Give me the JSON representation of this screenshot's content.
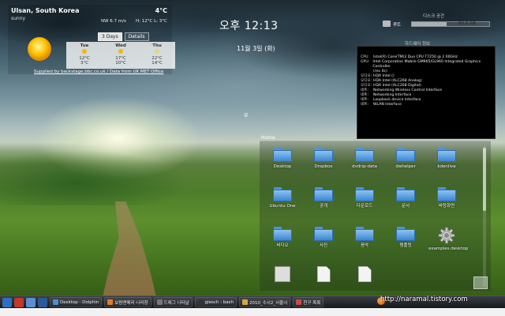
{
  "weather": {
    "city": "Ulsan, South Korea",
    "condition": "sunny",
    "temperature": "4°C",
    "wind": "NW 6.7 m/s",
    "hi_lo": "H: 12°C L: 3°C",
    "tabs": [
      "3 Days",
      "Details"
    ],
    "active_tab": 0,
    "forecast": [
      {
        "day": "Tue",
        "high": "12°C",
        "low": "3°C",
        "icon": "sun-icon"
      },
      {
        "day": "Wed",
        "high": "17°C",
        "low": "10°C",
        "icon": "sun-icon"
      },
      {
        "day": "Thu",
        "high": "22°C",
        "low": "14°C",
        "icon": "cloud-sun-icon"
      }
    ],
    "supplier": "Supplied by backstage.bbc.co.uk / Data from UK MET Office"
  },
  "clock": {
    "time": "오후 12:13",
    "date": "11월 3일 (화)"
  },
  "disk": {
    "title": "디스크 공간",
    "label": "루트",
    "value": "60.0 GB",
    "usage_fraction": 0.45
  },
  "sysinfo": {
    "title": "하드웨어 정보",
    "rows": [
      {
        "k": "CPU:",
        "v": "Intel(R) Core(TM)2 Duo CPU T7250 @ 2.00GHz"
      },
      {
        "k": "GPU:",
        "v": "Intel Corporation Mobile GM965/GL960 Integrated Graphics Controller"
      },
      {
        "k": "",
        "v": "(rev 0c)"
      },
      {
        "k": "오디오:",
        "v": "HDA Intel ()"
      },
      {
        "k": "오디오:",
        "v": "HDA Intel (ALC268 Analog)"
      },
      {
        "k": "오디오:",
        "v": "HDA Intel (ALC268 Digital)"
      },
      {
        "k": "네트:",
        "v": "Networking Wireless Control Interface"
      },
      {
        "k": "",
        "v": ""
      },
      {
        "k": "네트:",
        "v": "Networking Interface"
      },
      {
        "k": "",
        "v": ""
      },
      {
        "k": "네트:",
        "v": "Loopback device Interface"
      },
      {
        "k": "",
        "v": ""
      },
      {
        "k": "네트:",
        "v": "WLAN Interface"
      }
    ]
  },
  "mid_label": "뷰",
  "folderview": {
    "title": "Home",
    "items": [
      {
        "label": "Desktop",
        "type": "folder"
      },
      {
        "label": "Dropbox",
        "type": "folder"
      },
      {
        "label": "dvdrip-data",
        "type": "folder"
      },
      {
        "label": "dwhelper",
        "type": "folder"
      },
      {
        "label": "kdenlive",
        "type": "folder"
      },
      {
        "label": "Ubuntu One",
        "type": "folder"
      },
      {
        "label": "공개",
        "type": "folder"
      },
      {
        "label": "다운로드",
        "type": "folder"
      },
      {
        "label": "문서",
        "type": "folder"
      },
      {
        "label": "바탕화면",
        "type": "folder"
      },
      {
        "label": "비디오",
        "type": "folder"
      },
      {
        "label": "사진",
        "type": "folder"
      },
      {
        "label": "음악",
        "type": "folder"
      },
      {
        "label": "템플릿",
        "type": "folder"
      },
      {
        "label": "examples.desktop",
        "type": "gear"
      },
      {
        "label": "",
        "type": "image"
      },
      {
        "label": "",
        "type": "doc"
      },
      {
        "label": "",
        "type": "doc"
      }
    ]
  },
  "taskbar": {
    "tasks": [
      {
        "label": "Desktop - Dolphin",
        "icon": "dolphin-icon",
        "color": "#4a8fd8"
      },
      {
        "label": "보람앤메리 나리창",
        "icon": "firefox-icon",
        "color": "#e8782a"
      },
      {
        "label": "드래그 나타날",
        "icon": "window-icon",
        "color": "#777"
      },
      {
        "label": "giesch : bash",
        "icon": "terminal-icon",
        "color": "#333"
      },
      {
        "label": "2010_수시2_서울시",
        "icon": "document-icon",
        "color": "#d9a441"
      },
      {
        "label": "친구 목록",
        "icon": "chat-icon",
        "color": "#c84a4a"
      }
    ],
    "watermark": "http://naramal.tistory.com"
  },
  "colors": {
    "folder_blue": "#4f93d9",
    "panel_black": "#000000",
    "sun_yellow": "#f5b800"
  }
}
